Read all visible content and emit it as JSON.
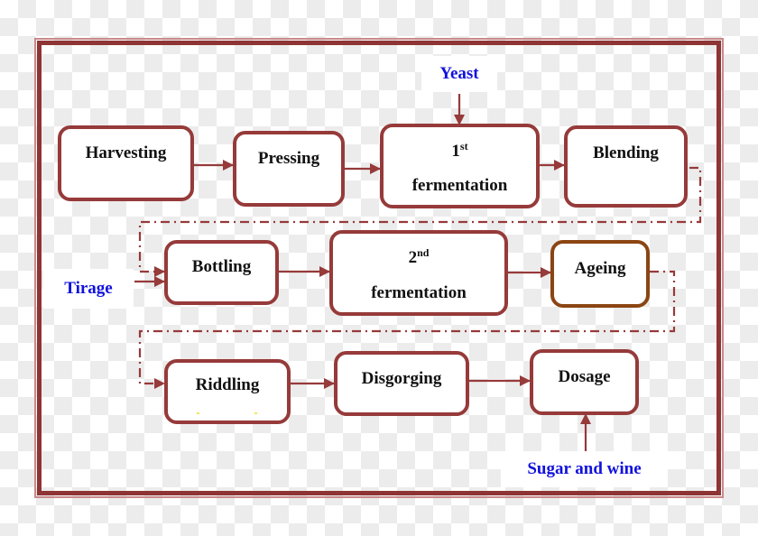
{
  "diagram": {
    "title": "",
    "colors": {
      "box_border": "#963a3a",
      "ageing_border": "#8b4513",
      "frame": "#8e3434",
      "input_text": "#1111dd",
      "step_text": "#111111"
    },
    "steps": [
      {
        "id": "harvesting",
        "label": "Harvesting"
      },
      {
        "id": "pressing",
        "label": "Pressing"
      },
      {
        "id": "first-fermentation",
        "ordinal": "1",
        "ordinal_suffix": "st",
        "label": "fermentation"
      },
      {
        "id": "blending",
        "label": "Blending"
      },
      {
        "id": "bottling",
        "label": "Bottling"
      },
      {
        "id": "second-fermentation",
        "ordinal": "2",
        "ordinal_suffix": "nd",
        "label": "fermentation"
      },
      {
        "id": "ageing",
        "label": "Ageing"
      },
      {
        "id": "riddling",
        "label": "Riddling"
      },
      {
        "id": "disgorging",
        "label": "Disgorging"
      },
      {
        "id": "dosage",
        "label": "Dosage"
      }
    ],
    "inputs": [
      {
        "id": "yeast",
        "label": "Yeast",
        "target": "first-fermentation"
      },
      {
        "id": "tirage",
        "label": "Tirage",
        "target": "bottling"
      },
      {
        "id": "sugar-and-wine",
        "label": "Sugar and wine",
        "target": "dosage"
      }
    ],
    "edges": [
      {
        "from": "harvesting",
        "to": "pressing",
        "style": "solid"
      },
      {
        "from": "pressing",
        "to": "first-fermentation",
        "style": "solid"
      },
      {
        "from": "first-fermentation",
        "to": "blending",
        "style": "solid"
      },
      {
        "from": "blending",
        "to": "bottling",
        "style": "dash-dot"
      },
      {
        "from": "bottling",
        "to": "second-fermentation",
        "style": "solid"
      },
      {
        "from": "second-fermentation",
        "to": "ageing",
        "style": "solid"
      },
      {
        "from": "ageing",
        "to": "riddling",
        "style": "dash-dot"
      },
      {
        "from": "riddling",
        "to": "disgorging",
        "style": "solid"
      },
      {
        "from": "disgorging",
        "to": "dosage",
        "style": "solid"
      },
      {
        "from": "yeast",
        "to": "first-fermentation",
        "style": "solid"
      },
      {
        "from": "tirage",
        "to": "bottling",
        "style": "solid"
      },
      {
        "from": "sugar-and-wine",
        "to": "dosage",
        "style": "solid"
      }
    ]
  }
}
